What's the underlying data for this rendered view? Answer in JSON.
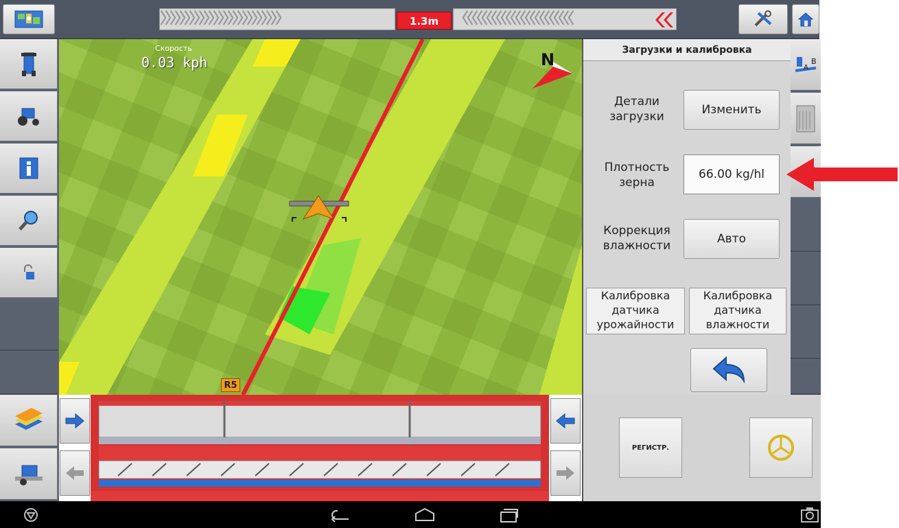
{
  "top_bar": {
    "lightbar_value": "1.3m",
    "left_chevrons": "〉〉〉〉〉〉〉〉〉〉〉〉〉〉〉〉〉〉〉〉〉〉〉〉〉",
    "right_chevrons": "〈〈〈〈〈〈〈〈〈〈〈〈〈〈〈〈〈〈〈〈〈〈〈",
    "icons": [
      "field-map-icon",
      "tools-icon",
      "home-icon"
    ]
  },
  "map": {
    "speed_label": "Скорость",
    "speed_value": "0.03 kph",
    "row_label": "R5",
    "north_label": "N"
  },
  "panel": {
    "title": "Загрузки и калибровка",
    "load_details_label": "Детали\nзагрузки",
    "edit_button": "Изменить",
    "grain_density_label": "Плотность\nзерна",
    "grain_density_value": "66.00 kg/hl",
    "moisture_label": "Коррекция\nвлажности",
    "moisture_button": "Авто",
    "cal_yield": "Калибровка\nдатчика\nурожайности",
    "cal_moisture": "Калибровка\nдатчика\nвлажности"
  },
  "bottom": {
    "register_button": "РЕГИСТР."
  },
  "colors": {
    "chrome": "#5d6573",
    "guidance_line": "#e8202a",
    "accent_blue": "#2e6fd0",
    "annotation_arrow": "#e8202a"
  }
}
